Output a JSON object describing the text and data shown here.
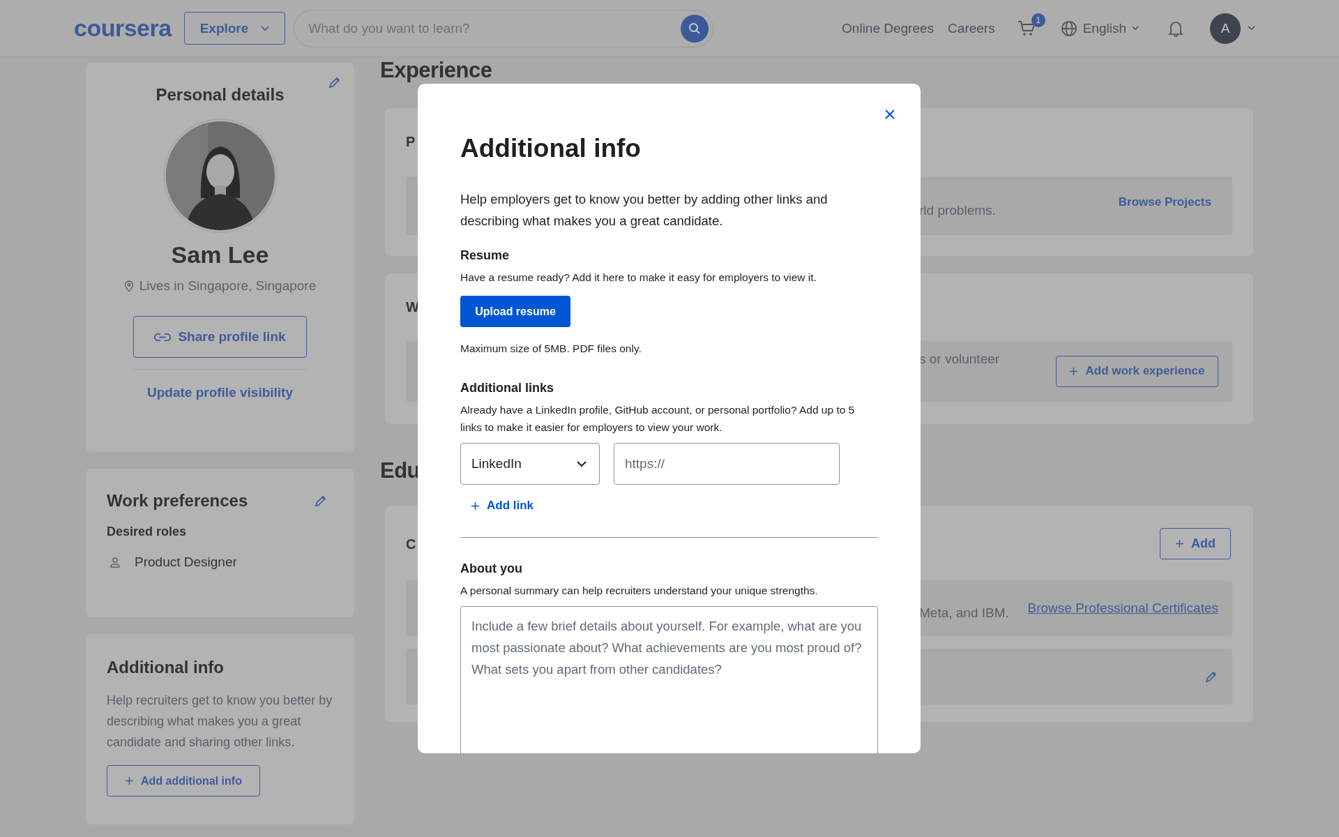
{
  "header": {
    "logo": "coursera",
    "explore": "Explore",
    "search": {
      "placeholder": "What do you want to learn?"
    },
    "links": [
      "Online Degrees",
      "Careers"
    ],
    "cart_count": "1",
    "language": "English",
    "avatar": "A"
  },
  "sidebar": {
    "personal": {
      "title": "Personal details",
      "name": "Sam Lee",
      "location": "Lives in Singapore, Singapore",
      "share": "Share profile link",
      "visibility": "Update profile visibility"
    },
    "preferences": {
      "title": "Work preferences",
      "subtitle": "Desired roles",
      "roles": [
        "Product Designer"
      ]
    },
    "additional": {
      "title": "Additional info",
      "text": "Help recruiters get to know you better by describing what makes you a great candidate and sharing other links.",
      "button": "Add additional info"
    }
  },
  "main": {
    "experience_heading": "Experience",
    "projects": {
      "title": "P",
      "text": "rld problems.",
      "link": "Browse Projects"
    },
    "work": {
      "title": "W",
      "text": "s or volunteer",
      "button": "Add work experience"
    },
    "education_heading": "Edu",
    "education": {
      "title": "C",
      "button": "Add",
      "text": "Meta, and IBM.",
      "link": "Browse Professional Certificates"
    }
  },
  "modal": {
    "title": "Additional info",
    "intro": "Help employers get to know you better by adding other links and describing what makes you a great candidate.",
    "resume": {
      "heading": "Resume",
      "text": "Have a resume ready? Add it here to make it easy for employers to view it.",
      "button": "Upload resume",
      "note": "Maximum size of 5MB. PDF files only."
    },
    "links": {
      "heading": "Additional links",
      "text": "Already have a LinkedIn profile, GitHub account, or personal portfolio? Add up to 5 links to make it easier for employers to view your work.",
      "rows": [
        {
          "type": "LinkedIn",
          "placeholder": "https://"
        }
      ],
      "add": "Add link"
    },
    "about": {
      "heading": "About you",
      "text": "A personal summary can help recruiters understand your unique strengths.",
      "placeholder": "Include a few brief details about yourself. For example, what are you most passionate about? What achievements are you most proud of? What sets you apart from other candidates?"
    }
  }
}
